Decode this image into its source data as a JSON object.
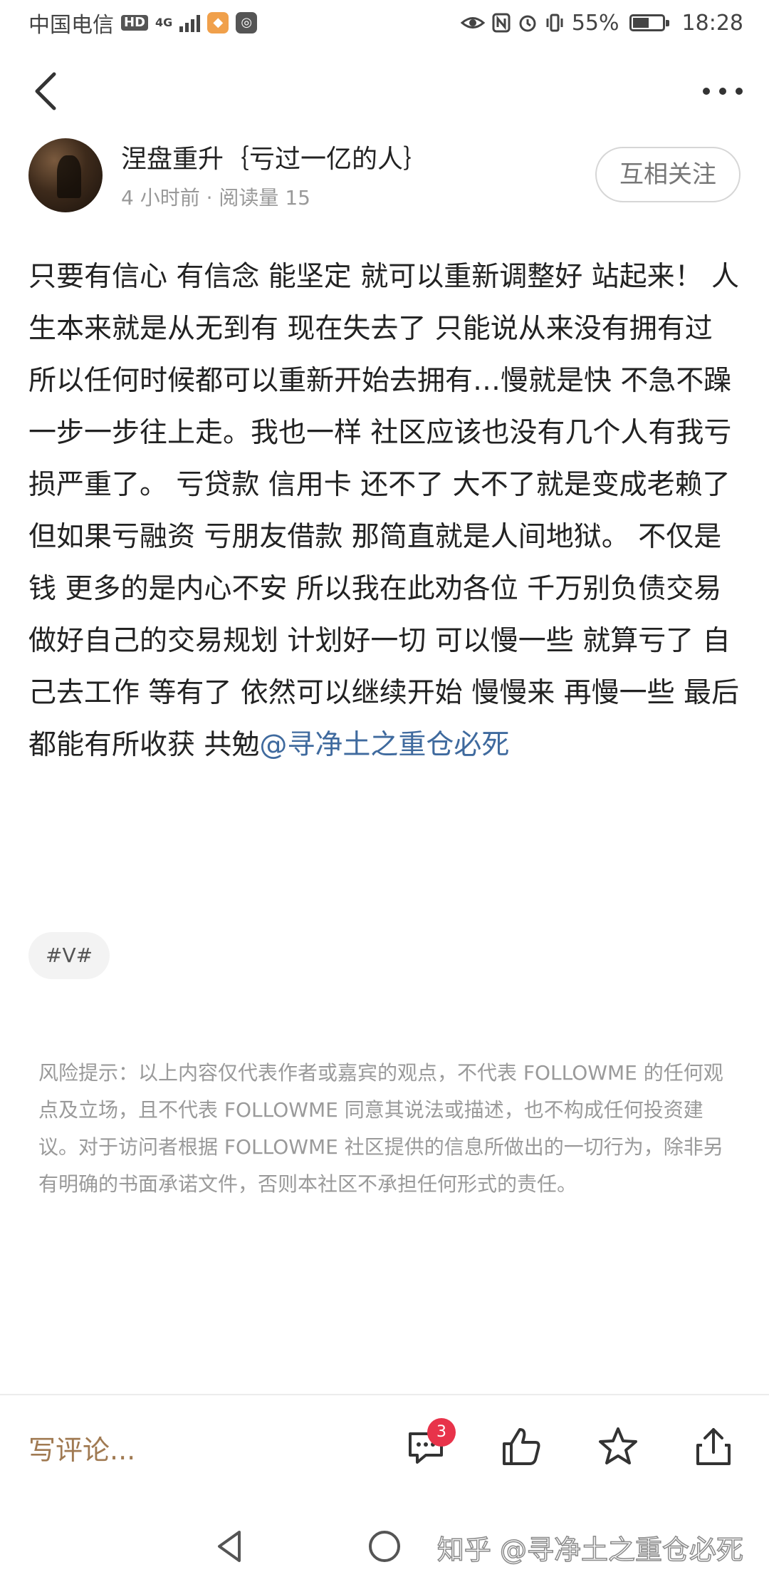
{
  "status_bar": {
    "carrier": "中国电信",
    "hd_badge": "HD",
    "network": "4G",
    "battery_percent": "55%",
    "battery_level": 0.55,
    "time": "18:28"
  },
  "author": {
    "name": "涅盘重升｛亏过一亿的人｝",
    "meta": "4 小时前 · 阅读量 15",
    "follow_label": "互相关注"
  },
  "post": {
    "body": "只要有信心 有信念 能坚定 就可以重新调整好 站起来！ 人生本来就是从无到有 现在失去了 只能说从来没有拥有过 所以任何时候都可以重新开始去拥有…慢就是快 不急不躁 一步一步往上走。我也一样 社区应该也没有几个人有我亏损严重了。 亏贷款 信用卡 还不了 大不了就是变成老赖了 但如果亏融资 亏朋友借款 那简直就是人间地狱。 不仅是钱 更多的是内心不安 所以我在此劝各位 千万别负债交易 做好自己的交易规划 计划好一切 可以慢一些 就算亏了 自己去工作 等有了 依然可以继续开始 慢慢来 再慢一些 最后都能有所收获 共勉",
    "mention": "@寻净土之重仓必死",
    "tag": "#V#"
  },
  "disclaimer": "风险提示：以上内容仅代表作者或嘉宾的观点，不代表 FOLLOWME 的任何观点及立场，且不代表 FOLLOWME 同意其说法或描述，也不构成任何投资建议。对于访问者根据 FOLLOWME 社区提供的信息所做出的一切行为，除非另有明确的书面承诺文件，否则本社区不承担任何形式的责任。",
  "bottom_bar": {
    "comment_placeholder": "写评论...",
    "comment_count": "3"
  },
  "watermark": "知乎 @寻净土之重仓必死",
  "icons": {
    "back": "back-arrow-icon",
    "more": "more-dots-icon",
    "comment": "comment-icon",
    "like": "thumbs-up-icon",
    "favorite": "star-icon",
    "share": "share-icon",
    "nav_back": "nav-back-icon",
    "nav_home": "nav-home-icon"
  },
  "colors": {
    "mention": "#3f6a9e",
    "comment_placeholder": "#a07a52",
    "badge": "#e8334a",
    "disclaimer": "#9a9a9a"
  }
}
